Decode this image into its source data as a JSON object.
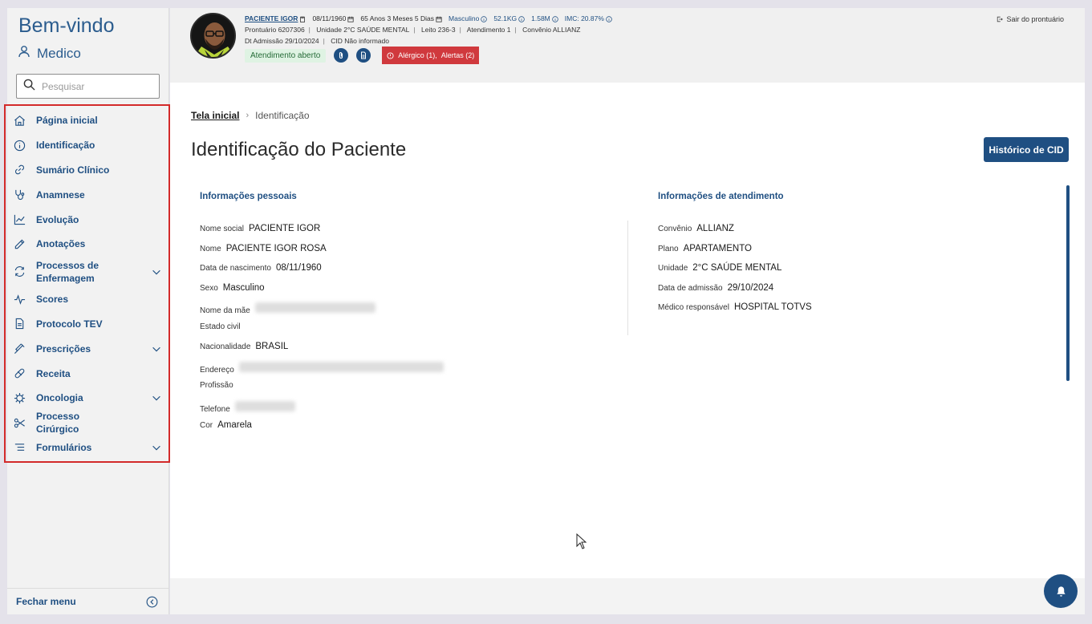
{
  "sidebar": {
    "welcome": "Bem-vindo",
    "user": "Medico",
    "search_placeholder": "Pesquisar",
    "items": [
      {
        "label": "Página inicial",
        "icon": "home-icon"
      },
      {
        "label": "Identificação",
        "icon": "info-icon"
      },
      {
        "label": "Sumário Clínico",
        "icon": "link-icon"
      },
      {
        "label": "Anamnese",
        "icon": "stethoscope-icon"
      },
      {
        "label": "Evolução",
        "icon": "trend-chart-icon"
      },
      {
        "label": "Anotações",
        "icon": "pencil-icon"
      },
      {
        "label": "Processos de Enfermagem",
        "icon": "refresh-icon"
      },
      {
        "label": "Scores",
        "icon": "pulse-icon"
      },
      {
        "label": "Protocolo TEV",
        "icon": "document-icon"
      },
      {
        "label": "Prescrições",
        "icon": "syringe-icon"
      },
      {
        "label": "Receita",
        "icon": "pill-icon"
      },
      {
        "label": "Oncologia",
        "icon": "virus-icon"
      },
      {
        "label": "Processo Cirúrgico",
        "icon": "scissors-icon"
      },
      {
        "label": "Formulários",
        "icon": "list-icon"
      }
    ],
    "footer": "Fechar menu"
  },
  "header": {
    "patient_name": "PACIENTE IGOR",
    "birth_date": "08/11/1960",
    "age": "65 Anos 3 Meses 5 Dias",
    "sex": "Masculino",
    "weight": "52.1KG",
    "height": "1.58M",
    "imc": "IMC: 20.87%",
    "prontuario": "Prontuário 6207306",
    "unidade": "Unidade 2°C SAÚDE MENTAL",
    "leito": "Leito 236-3",
    "atendimento": "Atendimento 1",
    "convenio": "Convênio ALLIANZ",
    "admissao": "Dt Admissão 29/10/2024",
    "cid": "CID Não informado",
    "status": "Atendimento aberto",
    "alert_allergic": "Alérgico (1),",
    "alert_alerts": "Alertas (2)",
    "logout": "Sair do prontuário"
  },
  "main": {
    "breadcrumb_home": "Tela inicial",
    "breadcrumb_current": "Identificação",
    "title": "Identificação do Paciente",
    "cid_history": "Histórico de CID",
    "personal_title": "Informações pessoais",
    "service_title": "Informações de atendimento",
    "personal": {
      "social_name_label": "Nome social",
      "social_name": "PACIENTE IGOR",
      "name_label": "Nome",
      "name": "PACIENTE IGOR ROSA",
      "birth_label": "Data de nascimento",
      "birth": "08/11/1960",
      "sex_label": "Sexo",
      "sex": "Masculino",
      "mother_label": "Nome da mãe",
      "civil_label": "Estado civil",
      "nationality_label": "Nacionalidade",
      "nationality": "BRASIL",
      "address_label": "Endereço",
      "profession_label": "Profissão",
      "phone_label": "Telefone",
      "color_label": "Cor",
      "color": "Amarela"
    },
    "service": {
      "insurance_label": "Convênio",
      "insurance": "ALLIANZ",
      "plan_label": "Plano",
      "plan": "APARTAMENTO",
      "unit_label": "Unidade",
      "unit": "2°C SAÚDE MENTAL",
      "admission_label": "Data de admissão",
      "admission": "29/10/2024",
      "doctor_label": "Médico responsável",
      "doctor": "HOSPITAL TOTVS"
    }
  },
  "colors": {
    "primary": "#1f4f82",
    "alert": "#d0393d",
    "highlight_border": "#d32a2a",
    "status_bg": "#dff3e3"
  }
}
